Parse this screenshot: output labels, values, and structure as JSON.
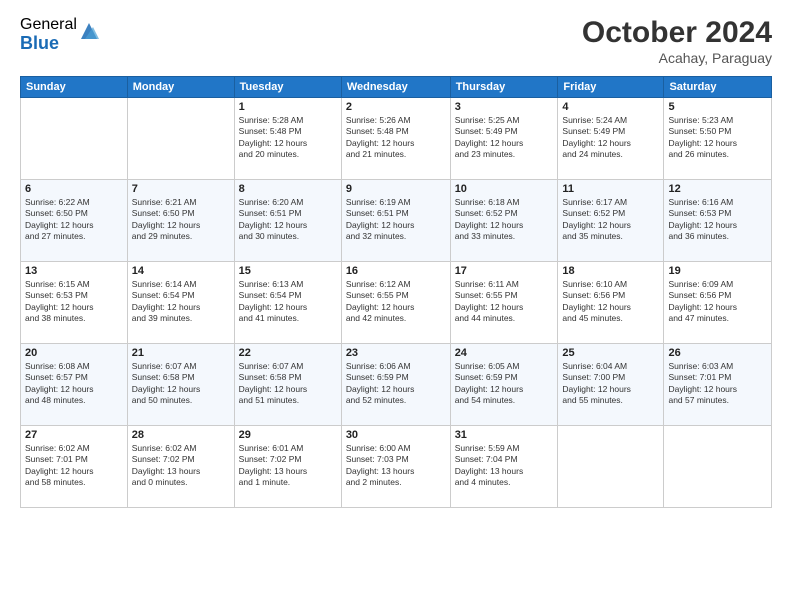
{
  "header": {
    "logo_general": "General",
    "logo_blue": "Blue",
    "month_title": "October 2024",
    "subtitle": "Acahay, Paraguay"
  },
  "weekdays": [
    "Sunday",
    "Monday",
    "Tuesday",
    "Wednesday",
    "Thursday",
    "Friday",
    "Saturday"
  ],
  "weeks": [
    [
      {
        "day": "",
        "info": ""
      },
      {
        "day": "",
        "info": ""
      },
      {
        "day": "1",
        "info": "Sunrise: 5:28 AM\nSunset: 5:48 PM\nDaylight: 12 hours\nand 20 minutes."
      },
      {
        "day": "2",
        "info": "Sunrise: 5:26 AM\nSunset: 5:48 PM\nDaylight: 12 hours\nand 21 minutes."
      },
      {
        "day": "3",
        "info": "Sunrise: 5:25 AM\nSunset: 5:49 PM\nDaylight: 12 hours\nand 23 minutes."
      },
      {
        "day": "4",
        "info": "Sunrise: 5:24 AM\nSunset: 5:49 PM\nDaylight: 12 hours\nand 24 minutes."
      },
      {
        "day": "5",
        "info": "Sunrise: 5:23 AM\nSunset: 5:50 PM\nDaylight: 12 hours\nand 26 minutes."
      }
    ],
    [
      {
        "day": "6",
        "info": "Sunrise: 6:22 AM\nSunset: 6:50 PM\nDaylight: 12 hours\nand 27 minutes."
      },
      {
        "day": "7",
        "info": "Sunrise: 6:21 AM\nSunset: 6:50 PM\nDaylight: 12 hours\nand 29 minutes."
      },
      {
        "day": "8",
        "info": "Sunrise: 6:20 AM\nSunset: 6:51 PM\nDaylight: 12 hours\nand 30 minutes."
      },
      {
        "day": "9",
        "info": "Sunrise: 6:19 AM\nSunset: 6:51 PM\nDaylight: 12 hours\nand 32 minutes."
      },
      {
        "day": "10",
        "info": "Sunrise: 6:18 AM\nSunset: 6:52 PM\nDaylight: 12 hours\nand 33 minutes."
      },
      {
        "day": "11",
        "info": "Sunrise: 6:17 AM\nSunset: 6:52 PM\nDaylight: 12 hours\nand 35 minutes."
      },
      {
        "day": "12",
        "info": "Sunrise: 6:16 AM\nSunset: 6:53 PM\nDaylight: 12 hours\nand 36 minutes."
      }
    ],
    [
      {
        "day": "13",
        "info": "Sunrise: 6:15 AM\nSunset: 6:53 PM\nDaylight: 12 hours\nand 38 minutes."
      },
      {
        "day": "14",
        "info": "Sunrise: 6:14 AM\nSunset: 6:54 PM\nDaylight: 12 hours\nand 39 minutes."
      },
      {
        "day": "15",
        "info": "Sunrise: 6:13 AM\nSunset: 6:54 PM\nDaylight: 12 hours\nand 41 minutes."
      },
      {
        "day": "16",
        "info": "Sunrise: 6:12 AM\nSunset: 6:55 PM\nDaylight: 12 hours\nand 42 minutes."
      },
      {
        "day": "17",
        "info": "Sunrise: 6:11 AM\nSunset: 6:55 PM\nDaylight: 12 hours\nand 44 minutes."
      },
      {
        "day": "18",
        "info": "Sunrise: 6:10 AM\nSunset: 6:56 PM\nDaylight: 12 hours\nand 45 minutes."
      },
      {
        "day": "19",
        "info": "Sunrise: 6:09 AM\nSunset: 6:56 PM\nDaylight: 12 hours\nand 47 minutes."
      }
    ],
    [
      {
        "day": "20",
        "info": "Sunrise: 6:08 AM\nSunset: 6:57 PM\nDaylight: 12 hours\nand 48 minutes."
      },
      {
        "day": "21",
        "info": "Sunrise: 6:07 AM\nSunset: 6:58 PM\nDaylight: 12 hours\nand 50 minutes."
      },
      {
        "day": "22",
        "info": "Sunrise: 6:07 AM\nSunset: 6:58 PM\nDaylight: 12 hours\nand 51 minutes."
      },
      {
        "day": "23",
        "info": "Sunrise: 6:06 AM\nSunset: 6:59 PM\nDaylight: 12 hours\nand 52 minutes."
      },
      {
        "day": "24",
        "info": "Sunrise: 6:05 AM\nSunset: 6:59 PM\nDaylight: 12 hours\nand 54 minutes."
      },
      {
        "day": "25",
        "info": "Sunrise: 6:04 AM\nSunset: 7:00 PM\nDaylight: 12 hours\nand 55 minutes."
      },
      {
        "day": "26",
        "info": "Sunrise: 6:03 AM\nSunset: 7:01 PM\nDaylight: 12 hours\nand 57 minutes."
      }
    ],
    [
      {
        "day": "27",
        "info": "Sunrise: 6:02 AM\nSunset: 7:01 PM\nDaylight: 12 hours\nand 58 minutes."
      },
      {
        "day": "28",
        "info": "Sunrise: 6:02 AM\nSunset: 7:02 PM\nDaylight: 13 hours\nand 0 minutes."
      },
      {
        "day": "29",
        "info": "Sunrise: 6:01 AM\nSunset: 7:02 PM\nDaylight: 13 hours\nand 1 minute."
      },
      {
        "day": "30",
        "info": "Sunrise: 6:00 AM\nSunset: 7:03 PM\nDaylight: 13 hours\nand 2 minutes."
      },
      {
        "day": "31",
        "info": "Sunrise: 5:59 AM\nSunset: 7:04 PM\nDaylight: 13 hours\nand 4 minutes."
      },
      {
        "day": "",
        "info": ""
      },
      {
        "day": "",
        "info": ""
      }
    ]
  ]
}
